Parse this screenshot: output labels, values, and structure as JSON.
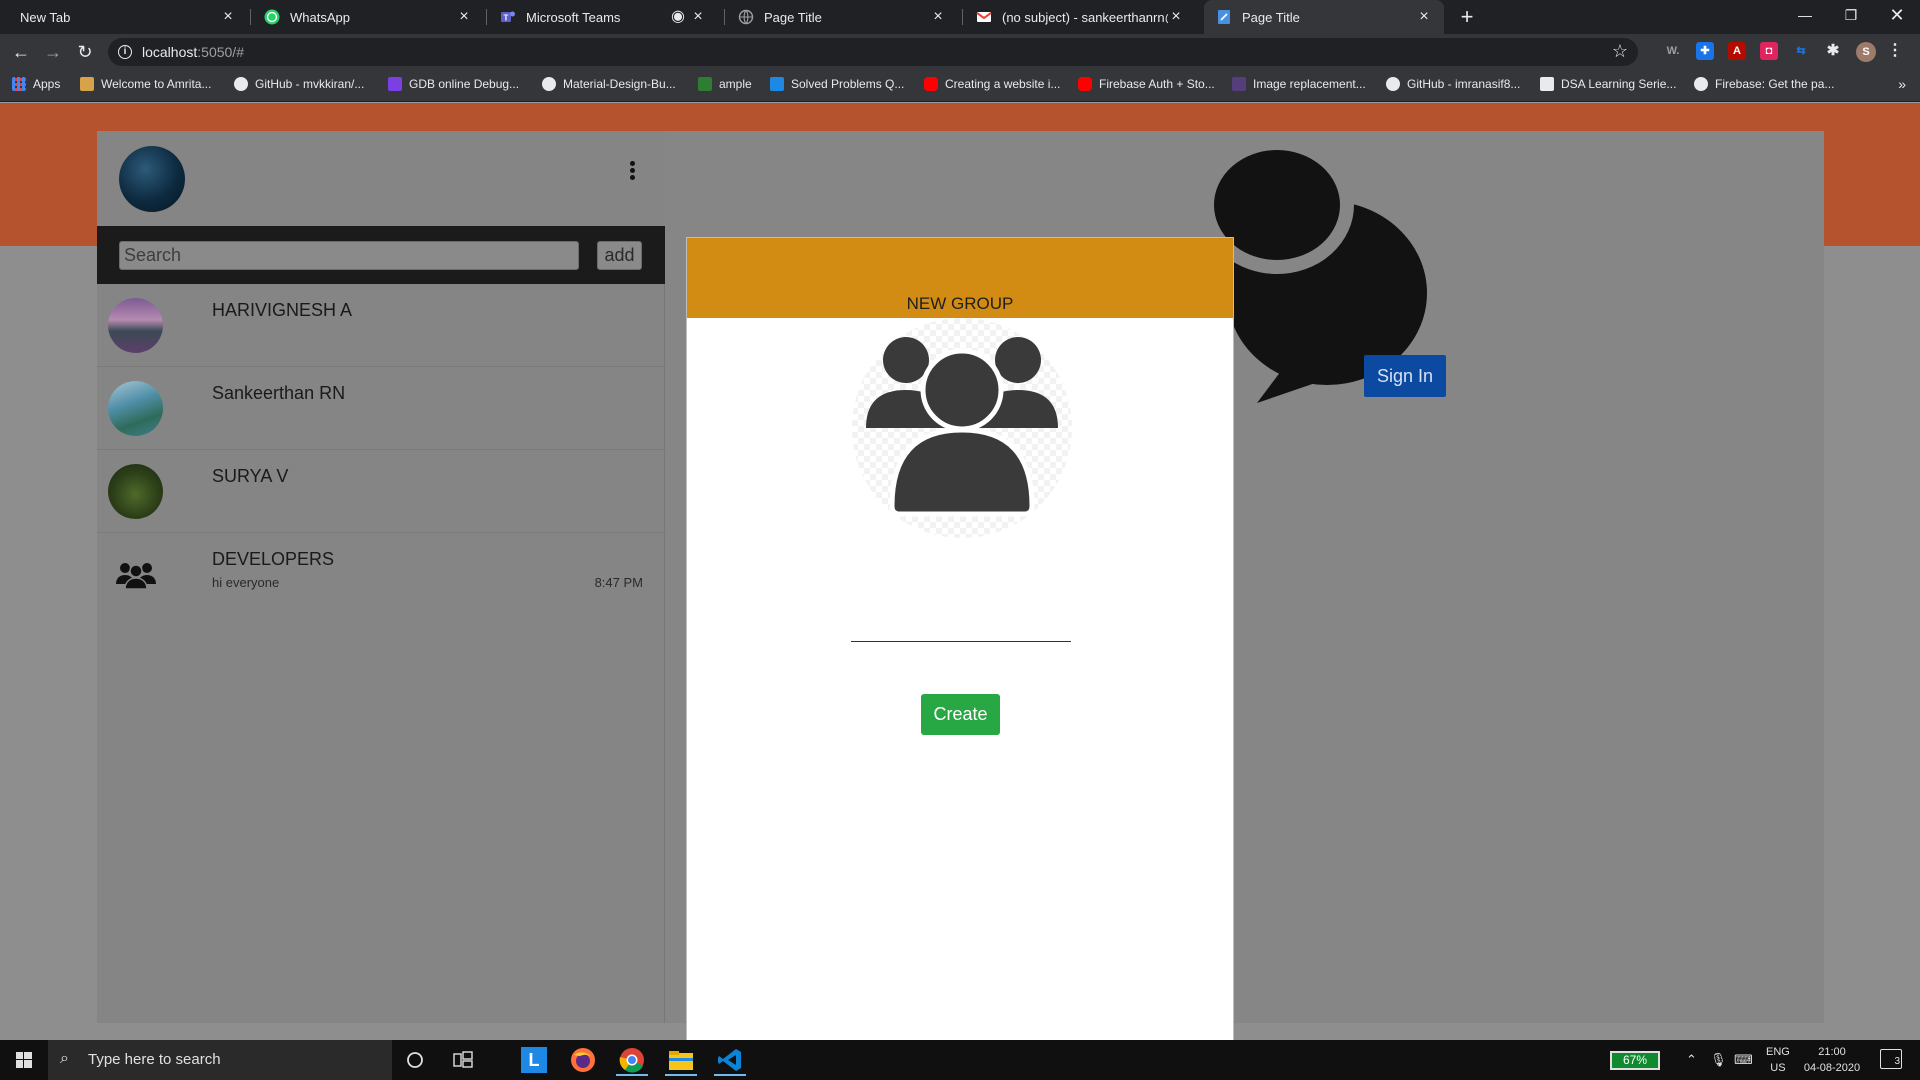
{
  "browser": {
    "tabs": [
      {
        "label": "New Tab",
        "icon": "none"
      },
      {
        "label": "WhatsApp",
        "icon": "whatsapp-icon"
      },
      {
        "label": "Microsoft Teams",
        "icon": "teams-icon"
      },
      {
        "label": "Page Title",
        "icon": "globe-icon"
      },
      {
        "label": "(no subject) - sankeerthanrn@gm",
        "icon": "gmail-icon"
      },
      {
        "label": "Page Title",
        "icon": "document-icon"
      }
    ],
    "url_host": "localhost",
    "url_rest": ":5050/#",
    "bookmarks": [
      "Apps",
      "Welcome to Amrita...",
      "GitHub - mvkkiran/...",
      "GDB online Debug...",
      "Material-Design-Bu...",
      "ample",
      "Solved Problems Q...",
      "Creating a website i...",
      "Firebase Auth + Sto...",
      "Image replacement...",
      "GitHub - imranasif8...",
      "DSA Learning Serie...",
      "Firebase: Get the pa..."
    ],
    "profile_initial": "S"
  },
  "sidebar": {
    "search_placeholder": "Search",
    "add_label": "add",
    "chats": [
      {
        "name": "HARIVIGNESH A",
        "subtitle": "",
        "time": ""
      },
      {
        "name": "Sankeerthan RN",
        "subtitle": "",
        "time": ""
      },
      {
        "name": "SURYA V",
        "subtitle": "",
        "time": ""
      },
      {
        "name": "DEVELOPERS",
        "subtitle": "hi everyone",
        "time": "8:47 PM"
      }
    ]
  },
  "main": {
    "signin_label": "Sign In"
  },
  "modal": {
    "title": "NEW GROUP",
    "group_name_value": "",
    "create_label": "Create"
  },
  "taskbar": {
    "search_placeholder": "Type here to search",
    "battery": "67%",
    "lang_line1": "ENG",
    "lang_line2": "US",
    "time": "21:00",
    "date": "04-08-2020",
    "notifications": "3"
  },
  "colors": {
    "modal_header": "#d28c14",
    "create_button": "#28a745",
    "signin_button": "#0b4aa0",
    "orange_band": "#b5532e"
  }
}
